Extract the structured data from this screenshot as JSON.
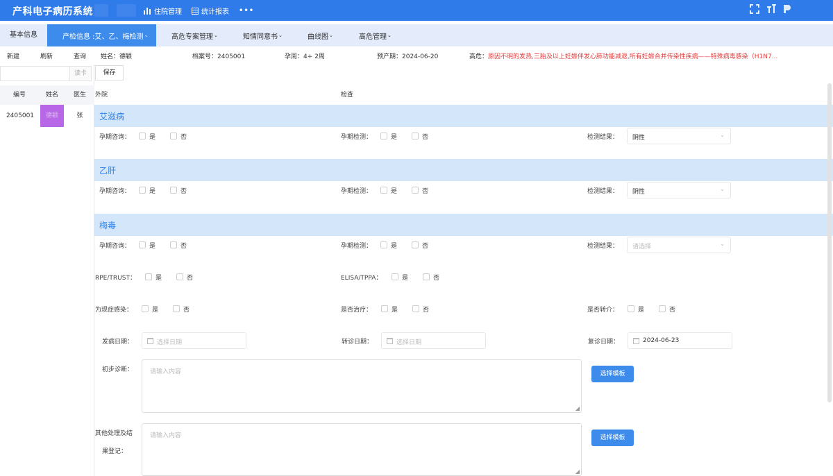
{
  "app": {
    "title": "产科电子病历系统",
    "nav": [
      "住院管理",
      "统计报表"
    ],
    "more": "•••",
    "accent": "#2f7bea"
  },
  "tabs": [
    {
      "label": "基本信息",
      "chevron": ""
    },
    {
      "label": "产检信息 :艾、乙、梅检测",
      "chevron": "⌄"
    },
    {
      "label": "高危专案管理",
      "chevron": "⌄"
    },
    {
      "label": "知情同意书",
      "chevron": "⌄"
    },
    {
      "label": "曲线图",
      "chevron": "⌄"
    },
    {
      "label": "高危管理",
      "chevron": "⌄"
    }
  ],
  "toolbar": {
    "new": "新建",
    "refresh": "刷新",
    "query": "查询"
  },
  "patient": {
    "name": "姓名：德颖",
    "archive": "档案号：2405001",
    "gestation": "孕周：4+ 2周",
    "due": "预产期：2024-06-20",
    "risk_label": "高危：",
    "risk_text": "原因不明的发热,三胎及以上妊娠伴发心肺功能减退,所有妊娠合并传染性疾病——特殊病毒感染（H1N7..."
  },
  "left": {
    "read_card": "读卡",
    "columns": [
      "编号",
      "姓名",
      "医生"
    ],
    "rows": [
      {
        "id": "2405001",
        "name": "德颖",
        "doctor": "张"
      }
    ]
  },
  "form": {
    "save": "保存",
    "col_outpatient": "外院",
    "col_exam": "检查",
    "sections": [
      "艾滋病",
      "乙肝",
      "梅毒"
    ],
    "consult_label": "孕期咨询：",
    "test_label": "孕期检测：",
    "result_label": "检测结果：",
    "yes": "是",
    "no": "否",
    "results": [
      "阴性",
      "阴性",
      "请选择"
    ],
    "rpe_label": "RPE/TRUST：",
    "elisa_label": "ELISA/TPPA：",
    "infection_label": "为现症感染：",
    "treat_label": "是否治疗：",
    "transfer_label": "是否转介：",
    "onset_label": "发病日期：",
    "transfer_date_label": "转诊日期：",
    "revisit_label": "复诊日期：",
    "date_placeholder": "选择日期",
    "revisit_value": "2024-06-23",
    "diagnosis_label": "初步诊断：",
    "other_label_1": "其他处理及结",
    "other_label_2": "果登记：",
    "textarea_placeholder": "请输入内容",
    "template_button": "选择模板"
  }
}
